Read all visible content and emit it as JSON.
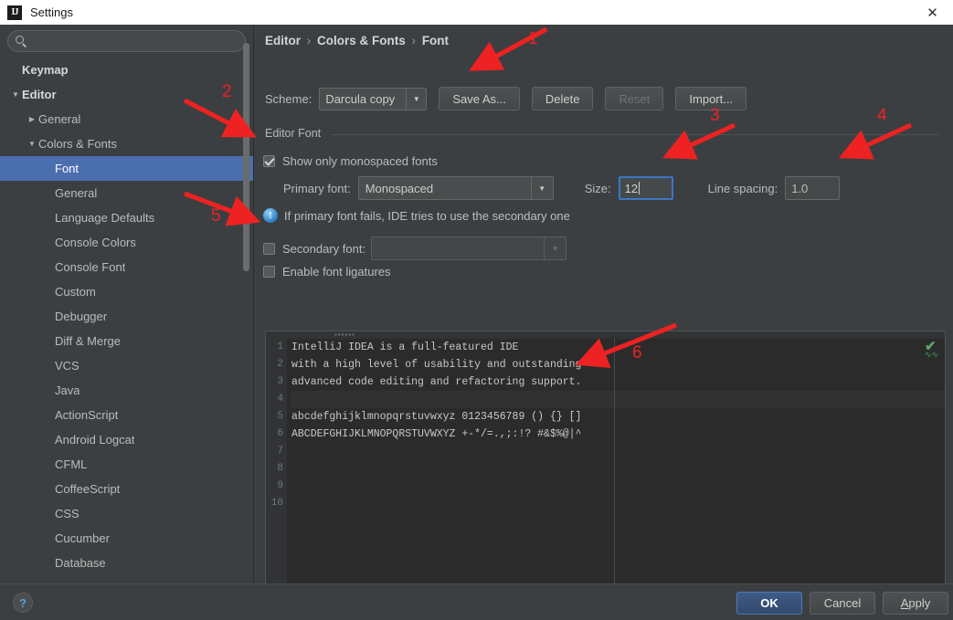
{
  "window": {
    "title": "Settings",
    "app_icon": "intellij-idea-icon",
    "close_icon": "close-icon"
  },
  "sidebar": {
    "search": {
      "value": "",
      "placeholder": "",
      "icon": "search-icon"
    },
    "items": [
      {
        "label": "Keymap",
        "indent": 0,
        "twisty": "",
        "bold": true,
        "selected": false
      },
      {
        "label": "Editor",
        "indent": 0,
        "twisty": "▼",
        "bold": true,
        "selected": false
      },
      {
        "label": "General",
        "indent": 1,
        "twisty": "▶",
        "bold": false,
        "selected": false
      },
      {
        "label": "Colors & Fonts",
        "indent": 1,
        "twisty": "▼",
        "bold": false,
        "selected": false
      },
      {
        "label": "Font",
        "indent": 2,
        "twisty": "",
        "bold": false,
        "selected": true
      },
      {
        "label": "General",
        "indent": 2,
        "twisty": "",
        "bold": false,
        "selected": false
      },
      {
        "label": "Language Defaults",
        "indent": 2,
        "twisty": "",
        "bold": false,
        "selected": false
      },
      {
        "label": "Console Colors",
        "indent": 2,
        "twisty": "",
        "bold": false,
        "selected": false
      },
      {
        "label": "Console Font",
        "indent": 2,
        "twisty": "",
        "bold": false,
        "selected": false
      },
      {
        "label": "Custom",
        "indent": 2,
        "twisty": "",
        "bold": false,
        "selected": false
      },
      {
        "label": "Debugger",
        "indent": 2,
        "twisty": "",
        "bold": false,
        "selected": false
      },
      {
        "label": "Diff & Merge",
        "indent": 2,
        "twisty": "",
        "bold": false,
        "selected": false
      },
      {
        "label": "VCS",
        "indent": 2,
        "twisty": "",
        "bold": false,
        "selected": false
      },
      {
        "label": "Java",
        "indent": 2,
        "twisty": "",
        "bold": false,
        "selected": false
      },
      {
        "label": "ActionScript",
        "indent": 2,
        "twisty": "",
        "bold": false,
        "selected": false
      },
      {
        "label": "Android Logcat",
        "indent": 2,
        "twisty": "",
        "bold": false,
        "selected": false
      },
      {
        "label": "CFML",
        "indent": 2,
        "twisty": "",
        "bold": false,
        "selected": false
      },
      {
        "label": "CoffeeScript",
        "indent": 2,
        "twisty": "",
        "bold": false,
        "selected": false
      },
      {
        "label": "CSS",
        "indent": 2,
        "twisty": "",
        "bold": false,
        "selected": false
      },
      {
        "label": "Cucumber",
        "indent": 2,
        "twisty": "",
        "bold": false,
        "selected": false
      },
      {
        "label": "Database",
        "indent": 2,
        "twisty": "",
        "bold": false,
        "selected": false
      }
    ]
  },
  "panel": {
    "breadcrumb": {
      "part1": "Editor",
      "part2": "Colors & Fonts",
      "part3": "Font",
      "separator": "›"
    },
    "scheme": {
      "label": "Scheme:",
      "value": "Darcula copy",
      "dropdown_icon": "chevron-down-icon",
      "buttons": [
        {
          "label": "Save As...",
          "name": "save-as-button",
          "disabled": false
        },
        {
          "label": "Delete",
          "name": "delete-button",
          "disabled": false
        },
        {
          "label": "Reset",
          "name": "reset-button",
          "disabled": true
        },
        {
          "label": "Import...",
          "name": "import-button",
          "disabled": false
        }
      ]
    },
    "group_label": "Editor Font",
    "show_monospaced": {
      "label": "Show only monospaced fonts",
      "checked": true
    },
    "primary_font": {
      "label": "Primary font:",
      "value": "Monospaced",
      "dropdown_icon": "chevron-down-icon"
    },
    "size": {
      "label": "Size:",
      "value": "12"
    },
    "line_spacing": {
      "label": "Line spacing:",
      "value": "1.0"
    },
    "info": {
      "icon": "info-icon",
      "glyph": "!",
      "text": "If primary font fails, IDE tries to use the secondary one"
    },
    "secondary_font": {
      "label": "Secondary font:",
      "checked": false,
      "value": "",
      "dropdown_icon": "chevron-down-icon"
    },
    "ligatures": {
      "label": "Enable font ligatures",
      "checked": false
    }
  },
  "preview": {
    "inspection_icon": "green-check-icon",
    "inspection_glyph": "✔",
    "squiggle": "∿∿",
    "lines": [
      {
        "num": "1",
        "text": "IntelliJ IDEA is a full-featured IDE",
        "highlight": false
      },
      {
        "num": "2",
        "text": "with a high level of usability and outstanding",
        "highlight": false
      },
      {
        "num": "3",
        "text": "advanced code editing and refactoring support.",
        "highlight": false
      },
      {
        "num": "4",
        "text": "",
        "highlight": true
      },
      {
        "num": "5",
        "text": "abcdefghijklmnopqrstuvwxyz 0123456789 () {} []",
        "highlight": false
      },
      {
        "num": "6",
        "text": "ABCDEFGHIJKLMNOPQRSTUVWXYZ +-*/=.,;:!? #&$%@|^",
        "highlight": false
      },
      {
        "num": "7",
        "text": "",
        "highlight": false
      },
      {
        "num": "8",
        "text": "",
        "highlight": false
      },
      {
        "num": "9",
        "text": "",
        "highlight": false
      },
      {
        "num": "10",
        "text": "",
        "highlight": false
      }
    ]
  },
  "footer": {
    "help": {
      "glyph": "?",
      "name": "help-button"
    },
    "ok": "OK",
    "cancel": "Cancel",
    "apply_mnemonic": "A",
    "apply_rest": "pply"
  },
  "annotations": {
    "color": "#ee2222",
    "markers": [
      {
        "num": "1",
        "target": "save-as-button"
      },
      {
        "num": "2",
        "target": "sidebar-scrollbar-top"
      },
      {
        "num": "3",
        "target": "size-field"
      },
      {
        "num": "4",
        "target": "line-spacing-field"
      },
      {
        "num": "5",
        "target": "secondary-font-checkbox"
      },
      {
        "num": "6",
        "target": "preview-pane"
      }
    ]
  }
}
